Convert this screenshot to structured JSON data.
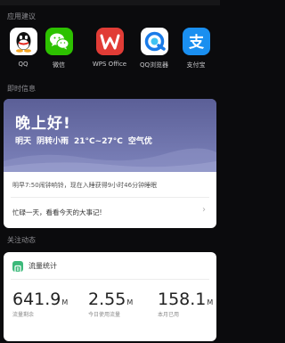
{
  "sections": {
    "apps_title": "应用建议",
    "instant_title": "即时信息",
    "follow_title": "关注动态"
  },
  "apps": [
    {
      "label": "QQ",
      "icon": "qq-icon",
      "color": "#ffffff"
    },
    {
      "label": "微信",
      "icon": "wechat-icon",
      "color": "#2dc100"
    },
    {
      "label": "WPS Office",
      "icon": "wps-icon",
      "color": "#e13c36"
    },
    {
      "label": "QQ浏览器",
      "icon": "qq-browser-icon",
      "color": "#ffffff"
    },
    {
      "label": "支付宝",
      "icon": "alipay-icon",
      "color": "#1a8ff0"
    }
  ],
  "weather": {
    "greeting": "晚上好!",
    "day": "明天",
    "condition": "阴转小雨",
    "temperature": "21°C~27°C",
    "air": "空气优"
  },
  "info": {
    "alarm_text": "明早7:50闹钟响铃，现在入睡获得9小时46分钟睡眠",
    "reminder_text": "忙碌一天，看看今天的大事记!"
  },
  "traffic": {
    "title": "流量统计",
    "stats": [
      {
        "value": "641.9",
        "unit": "M",
        "caption": "流量剩余"
      },
      {
        "value": "2.55",
        "unit": "M",
        "caption": "今日使用流量"
      },
      {
        "value": "158.1",
        "unit": "M",
        "caption": "本月已用"
      }
    ]
  }
}
